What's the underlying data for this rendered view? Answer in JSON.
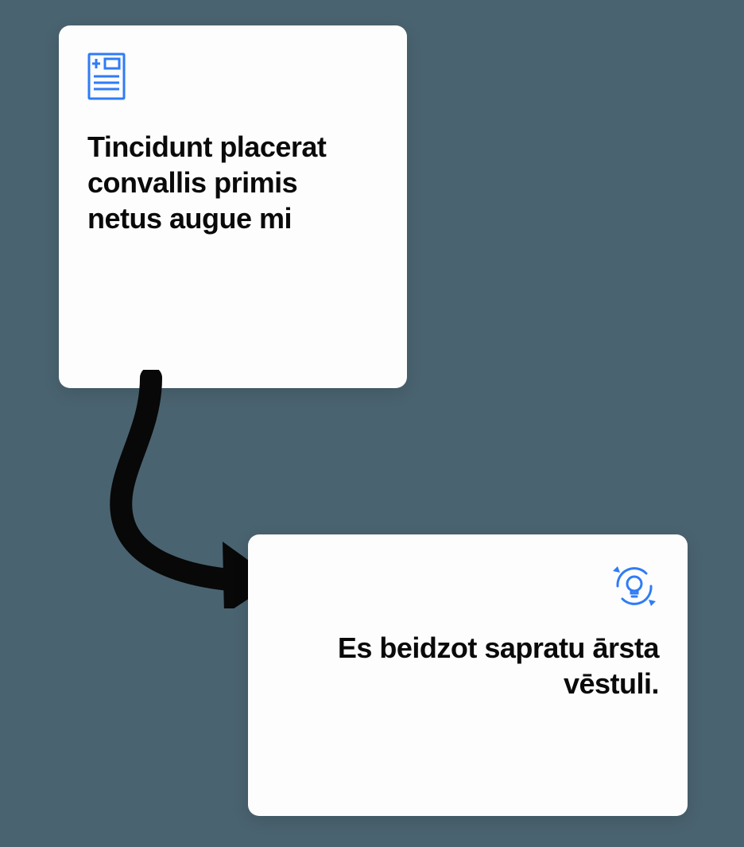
{
  "top_card": {
    "title": "Tincidunt placerat convallis primis netus augue mi"
  },
  "bottom_card": {
    "title": "Es beidzot sapratu ārsta vēstuli."
  }
}
